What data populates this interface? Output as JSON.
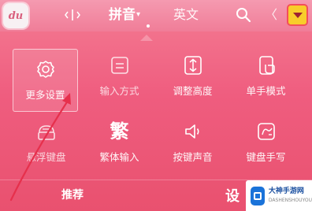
{
  "top_bar": {
    "logo_text": "du",
    "tabs": [
      {
        "label": "拼音",
        "caret": "▾",
        "active": true
      },
      {
        "label": "英文",
        "active": false
      }
    ],
    "side_glyph": "〈",
    "icons": [
      "cursor-icon",
      "search-icon",
      "collapse-icon"
    ],
    "collapse_color": "#f8cd2b"
  },
  "menu": {
    "items": [
      {
        "label": "更多设置",
        "icon": "gear-icon"
      },
      {
        "label": "输入方式",
        "icon": "input-method-icon"
      },
      {
        "label": "调整高度",
        "icon": "adjust-height-icon"
      },
      {
        "label": "单手模式",
        "icon": "one-hand-icon"
      },
      {
        "label": "悬浮键盘",
        "icon": "float-keyboard-icon"
      },
      {
        "label": "繁体输入",
        "icon_char": "繁"
      },
      {
        "label": "按键声音",
        "icon": "sound-icon"
      },
      {
        "label": "键盘手写",
        "icon": "handwriting-icon"
      }
    ]
  },
  "bottom": {
    "left_label": "推荐",
    "right_label": "设"
  },
  "watermark": {
    "title": "大神手游网",
    "subtitle": "DASHENSHOUYOU"
  },
  "colors": {
    "background": "#ef5d7f",
    "accent": "#f8cd2b",
    "arrow": "#e6304c"
  }
}
